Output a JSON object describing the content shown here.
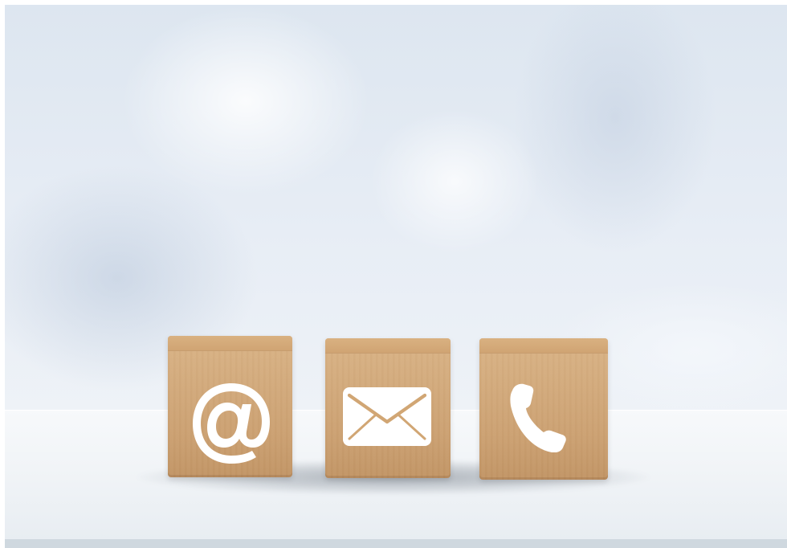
{
  "scene": {
    "icons": {
      "left_block": "at-sign-icon",
      "middle_block": "envelope-icon",
      "right_block": "phone-handset-icon"
    },
    "colors": {
      "background": "#e3eaf3",
      "tabletop": "#f2f5f8",
      "wood": "#d1a674",
      "icon": "#ffffff"
    }
  }
}
